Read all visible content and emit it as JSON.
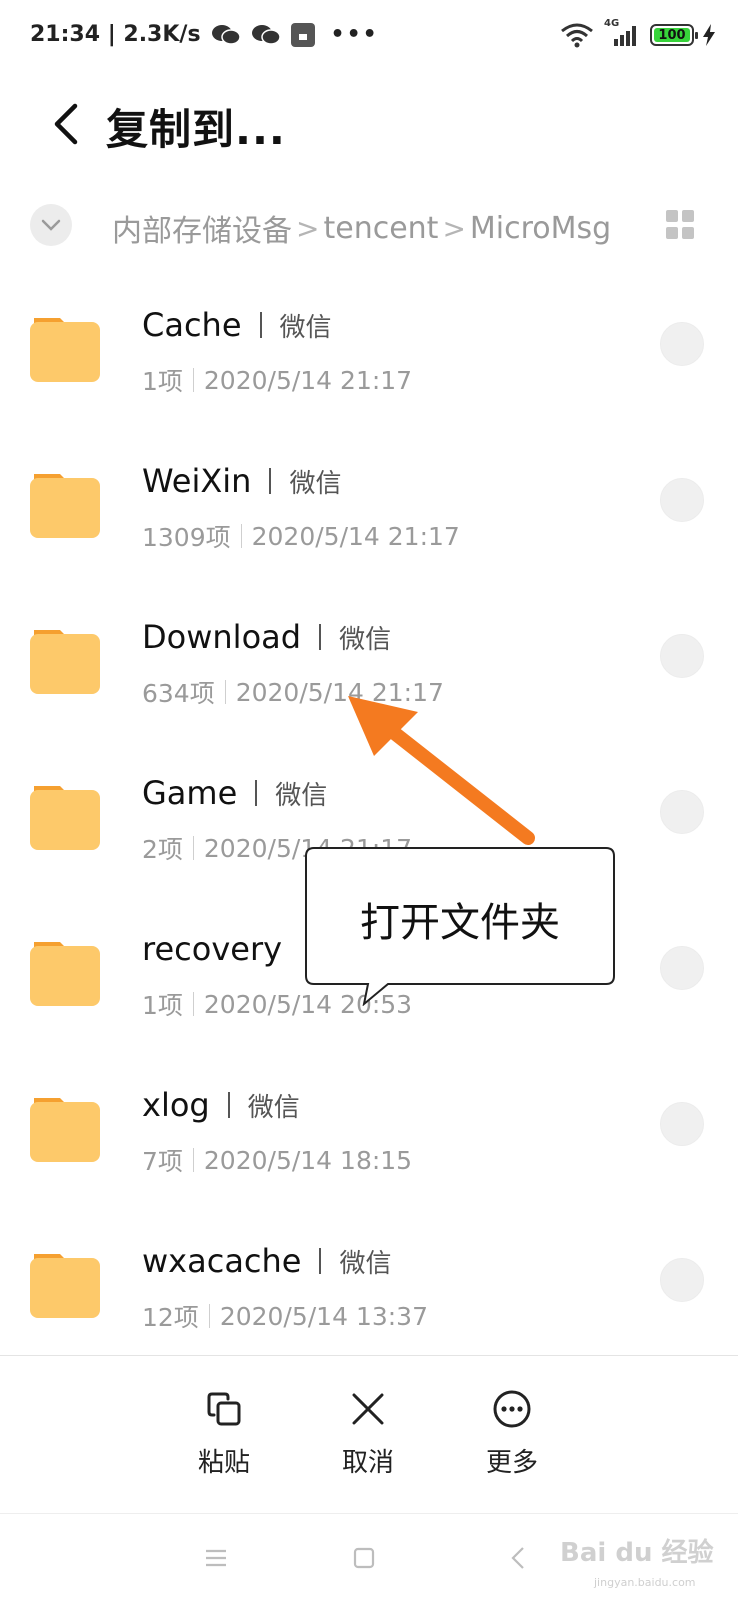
{
  "status_bar": {
    "time_speed": "21:34 | 2.3K/s",
    "network_label": "4G",
    "battery_level": "100",
    "battery_fraction": 1.0
  },
  "header": {
    "title": "复制到..."
  },
  "breadcrumb": {
    "items": [
      "内部存储设备",
      "tencent",
      "MicroMsg"
    ],
    "separator": ">"
  },
  "files": [
    {
      "name": "Cache",
      "tag": "微信",
      "count": "1项",
      "date": "2020/5/14 21:17"
    },
    {
      "name": "WeiXin",
      "tag": "微信",
      "count": "1309项",
      "date": "2020/5/14 21:17"
    },
    {
      "name": "Download",
      "tag": "微信",
      "count": "634项",
      "date": "2020/5/14 21:17"
    },
    {
      "name": "Game",
      "tag": "微信",
      "count": "2项",
      "date": "2020/5/14 21:17"
    },
    {
      "name": "recovery",
      "tag": "",
      "count": "1项",
      "date": "2020/5/14 20:53"
    },
    {
      "name": "xlog",
      "tag": "微信",
      "count": "7项",
      "date": "2020/5/14 18:15"
    },
    {
      "name": "wxacache",
      "tag": "微信",
      "count": "12项",
      "date": "2020/5/14 13:37"
    }
  ],
  "annotation": {
    "callout_text": "打开文件夹",
    "arrow_color": "#f47a20"
  },
  "actions": {
    "paste": "粘贴",
    "cancel": "取消",
    "more": "更多"
  },
  "watermark": {
    "text": "Bai du 经验",
    "sub": "jingyan.baidu.com"
  },
  "colors": {
    "folder_body": "#fdc96a",
    "folder_tab": "#f5a030",
    "secondary_text": "#9a9a9a"
  },
  "icons": {
    "back": "chevron-left-icon",
    "breadcrumb_toggle": "chevron-down-icon",
    "view_mode": "grid-view-icon",
    "folder": "folder-icon",
    "paste": "paste-icon",
    "cancel": "close-icon",
    "more": "more-dots-icon",
    "nav_menu": "menu-icon",
    "nav_home": "home-square-icon",
    "nav_back": "nav-back-icon"
  }
}
